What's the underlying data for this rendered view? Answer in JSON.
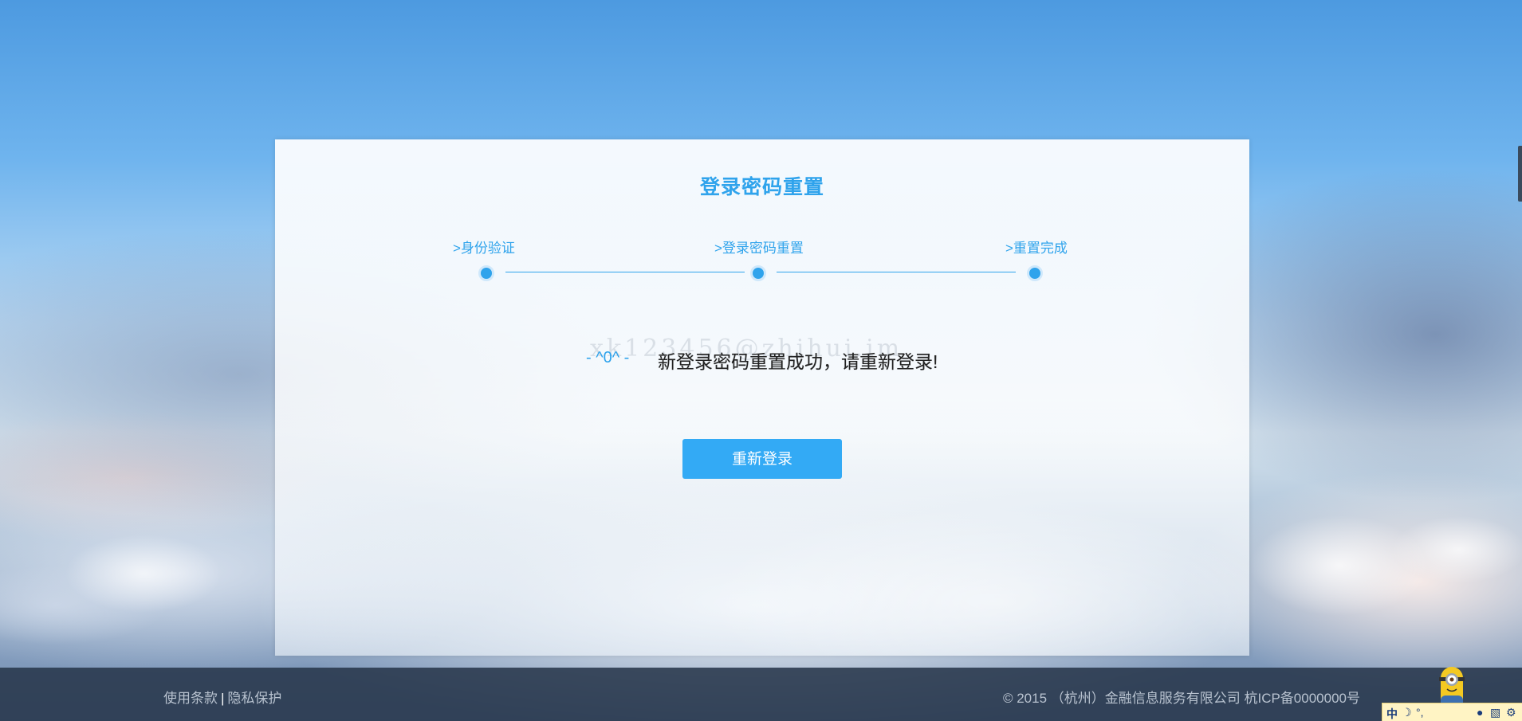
{
  "card": {
    "title": "登录密码重置",
    "steps": [
      {
        "label": ">身份验证"
      },
      {
        "label": ">登录密码重置"
      },
      {
        "label": ">重置完成"
      }
    ],
    "message_face": "- ^0^ -",
    "message": "新登录密码重置成功，请重新登录!",
    "watermark": "xk123456@zhihui.im",
    "button_label": "重新登录"
  },
  "footer": {
    "terms": "使用条款",
    "separator": "|",
    "privacy": "隐私保护",
    "copyright": "© 2015 （杭州）金融信息服务有限公司 杭ICP备0000000号"
  },
  "ime": {
    "mode": "中",
    "icons": [
      "moon-icon",
      "punctuation-icon",
      "microphone-icon",
      "keyboard-icon",
      "settings-icon"
    ]
  },
  "colors": {
    "accent": "#2fa3ec",
    "button": "#33aaf5",
    "footer_bg": "#28374b"
  }
}
